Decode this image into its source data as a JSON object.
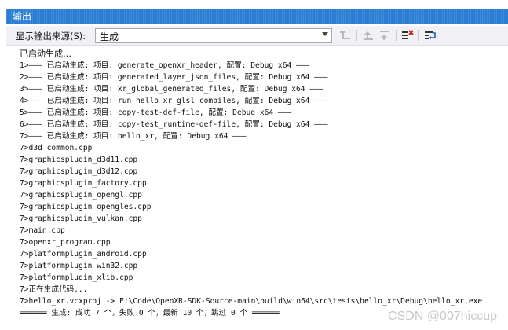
{
  "window": {
    "title": "输出"
  },
  "toolbar": {
    "source_label": "显示输出来源(S):",
    "source_value": "生成"
  },
  "output": {
    "lines": [
      "已启动生成…",
      "1>——— 已启动生成: 项目: generate_openxr_header, 配置: Debug x64 ———",
      "2>——— 已启动生成: 项目: generated_layer_json_files, 配置: Debug x64 ———",
      "3>——— 已启动生成: 项目: xr_global_generated_files, 配置: Debug x64 ———",
      "4>——— 已启动生成: 项目: run_hello_xr_glsl_compiles, 配置: Debug x64 ———",
      "5>——— 已启动生成: 项目: copy-test-def-file, 配置: Debug x64 ———",
      "6>——— 已启动生成: 项目: copy-test_runtime-def-file, 配置: Debug x64 ———",
      "7>——— 已启动生成: 项目: hello_xr, 配置: Debug x64 ———",
      "7>d3d_common.cpp",
      "7>graphicsplugin_d3d11.cpp",
      "7>graphicsplugin_d3d12.cpp",
      "7>graphicsplugin_factory.cpp",
      "7>graphicsplugin_opengl.cpp",
      "7>graphicsplugin_opengles.cpp",
      "7>graphicsplugin_vulkan.cpp",
      "7>main.cpp",
      "7>openxr_program.cpp",
      "7>platformplugin_android.cpp",
      "7>platformplugin_win32.cpp",
      "7>platformplugin_xlib.cpp",
      "7>正在生成代码...",
      "7>hello_xr.vcxproj -> E:\\Code\\OpenXR-SDK-Source-main\\build\\win64\\src\\tests\\hello_xr\\Debug\\hello_xr.exe",
      "══════ 生成: 成功 7 个，失败 0 个，最新 10 个，跳过 0 个 ══════"
    ]
  },
  "watermark": "CSDN @007hiccup"
}
